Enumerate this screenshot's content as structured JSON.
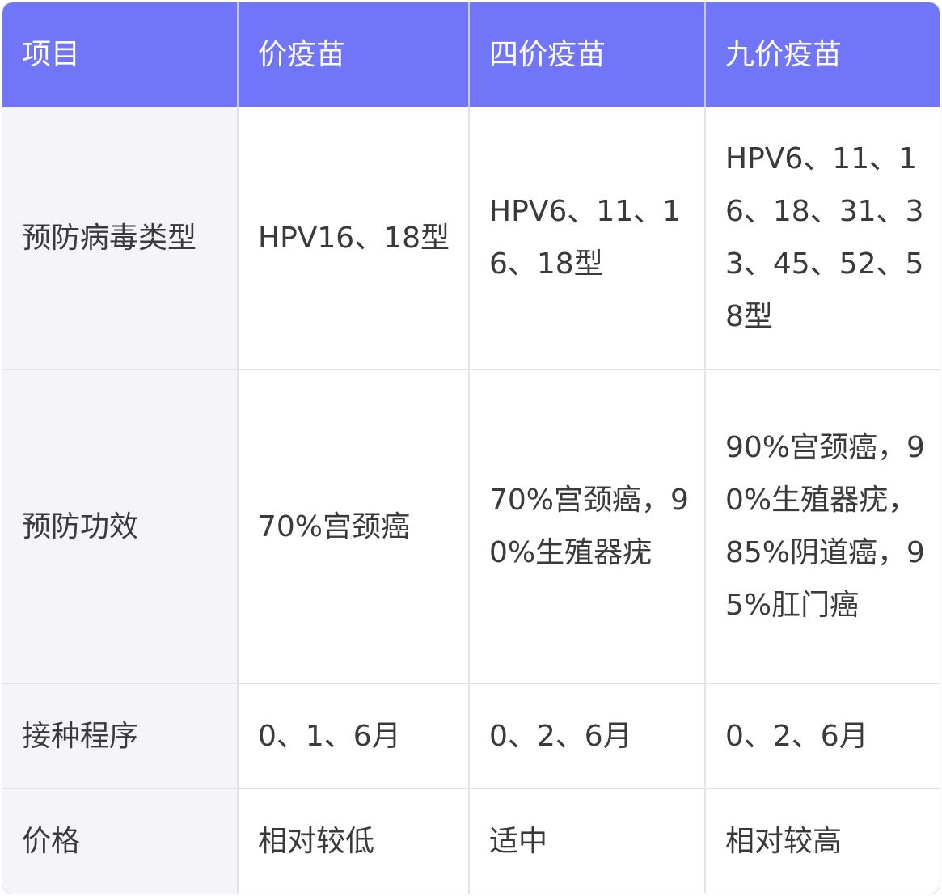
{
  "table": {
    "headers": [
      "项目",
      "价疫苗",
      "四价疫苗",
      "九价疫苗"
    ],
    "rows": [
      {
        "label": "预防病毒类型",
        "cells": [
          "HPV16、18型",
          "HPV6、11、16、18型",
          "HPV6、11、16、18、31、33、45、52、58型"
        ]
      },
      {
        "label": "预防功效",
        "cells": [
          "70%宫颈癌",
          "70%宫颈癌，90%生殖器疣",
          "90%宫颈癌，90%生殖器疣，85%阴道癌，95%肛门癌"
        ]
      },
      {
        "label": "接种程序",
        "cells": [
          "0、1、6月",
          "0、2、6月",
          "0、2、6月"
        ]
      },
      {
        "label": "价格",
        "cells": [
          "相对较低",
          "适中",
          "相对较高"
        ]
      }
    ]
  },
  "colors": {
    "header_bg": "#7076f7",
    "header_text": "#ffffff",
    "row_label_bg": "#f5f5f9",
    "text": "#3a3a3a",
    "border": "#e3e3ea"
  }
}
